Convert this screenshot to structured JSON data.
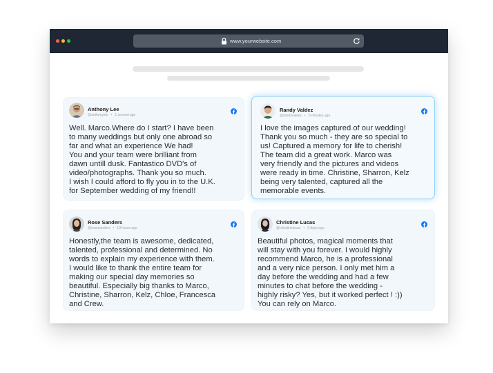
{
  "browser": {
    "url": "www.yourwebsite.com"
  },
  "colors": {
    "titlebar": "#1e2733",
    "card_background": "#f2f7fb",
    "highlight_border": "#8fd0f5",
    "facebook_blue": "#1877f2"
  },
  "reviews": [
    {
      "name": "Anthony Lee",
      "handle": "@anthonylee",
      "time": "1 second ago",
      "source_icon": "facebook-icon",
      "text": "Well. Marco.Where do I start? I have been\nto many weddings but only one abroad so\nfar and what an experience We had!\nYou and your team were brilliant from\ndawn untill dusk. Fantastico DVD's of\nvideo/photographs. Thank you so much.\nI wish I could afford to fly you in to the U.K.\nfor September wedding of my friend!!"
    },
    {
      "name": "Randy Valdez",
      "handle": "@randyvaldez",
      "time": "5 minutes ago",
      "source_icon": "facebook-icon",
      "text": "I love the images captured of our wedding!\nThank you so much - they are so special to\nus! Captured a memory for life to cherish!\nThe team did a great work. Marco was\nvery friendly and the pictures and videos\nwere ready in time. Christine, Sharron, Kelz\nbeing very talented, captured all the\nmemorable events."
    },
    {
      "name": "Rose Sanders",
      "handle": "@rosesanders",
      "time": "10 hours ago",
      "source_icon": "facebook-icon",
      "text": "Honestly,the team is awesome, dedicated,\ntalented, professional and determined. No\nwords to explain my experience with them.\nI would like to thank the entire team for\nmaking our special day memories so\nbeautiful. Especially big thanks to Marco,\nChristine, Sharron, Kelz, Chloe, Francesca\nand Crew."
    },
    {
      "name": "Christine Lucas",
      "handle": "@christinelucas",
      "time": "3 days ago",
      "source_icon": "facebook-icon",
      "text": "Beautiful photos, magical moments that\nwill stay with you forever. I would highly\nrecommend Marco, he is a professional\nand a very nice person. I only met him a\nday before the wedding and had a few\nminutes to chat before the wedding -\nhighly risky? Yes, but it worked perfect ! :))\nYou can rely on Marco."
    }
  ]
}
